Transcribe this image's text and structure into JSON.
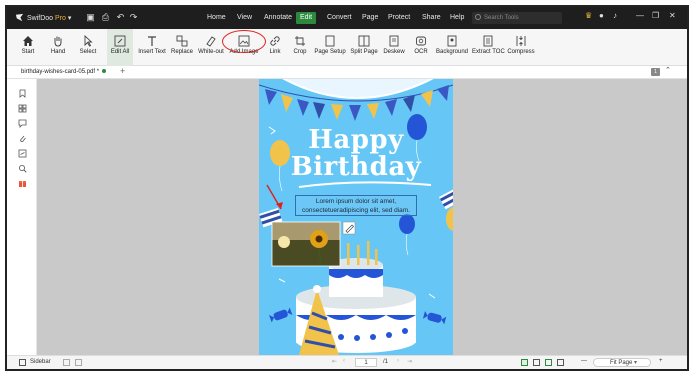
{
  "app": {
    "name": "SwifDoo",
    "badge": "Pro",
    "caret": "▾"
  },
  "menu": [
    {
      "label": "Home"
    },
    {
      "label": "View"
    },
    {
      "label": "Annotate"
    },
    {
      "label": "Edit",
      "active": true
    },
    {
      "label": "Convert"
    },
    {
      "label": "Page"
    },
    {
      "label": "Protect"
    },
    {
      "label": "Share"
    },
    {
      "label": "Help"
    }
  ],
  "search": {
    "placeholder": "Search Tools"
  },
  "toolbar": [
    {
      "label": "Start",
      "icon": "home-icon"
    },
    {
      "label": "Hand",
      "icon": "hand-icon"
    },
    {
      "label": "Select",
      "icon": "cursor-icon"
    },
    {
      "label": "Edit All",
      "icon": "edit-icon",
      "active": true
    },
    {
      "label": "Insert Text",
      "icon": "text-icon"
    },
    {
      "label": "Replace",
      "icon": "replace-icon"
    },
    {
      "label": "White-out",
      "icon": "eraser-icon"
    },
    {
      "label": "Add Image",
      "icon": "image-icon"
    },
    {
      "label": "Link",
      "icon": "link-icon"
    },
    {
      "label": "Crop",
      "icon": "crop-icon"
    },
    {
      "label": "Page Setup",
      "icon": "page-setup-icon"
    },
    {
      "label": "Split Page",
      "icon": "split-icon"
    },
    {
      "label": "Deskew",
      "icon": "deskew-icon"
    },
    {
      "label": "OCR",
      "icon": "ocr-icon"
    },
    {
      "label": "Background",
      "icon": "background-icon"
    },
    {
      "label": "Extract TOC",
      "icon": "toc-icon"
    },
    {
      "label": "Compress",
      "icon": "compress-icon"
    }
  ],
  "tab": {
    "filename": "birthday-wishes-card-05.pdf *",
    "add": "+",
    "count": "1",
    "collapse": "⌃"
  },
  "document": {
    "headline1": "Happy",
    "headline2": "Birthday",
    "body": "Lorem ipsum dolor sit amet, consectetueradipiscing elit, sed diam."
  },
  "status": {
    "sidebar_label": "Sidebar",
    "page_current": "1",
    "page_total": "/1",
    "zoom": "Fit Page",
    "zoom_minus": "—",
    "zoom_plus": "+"
  },
  "colors": {
    "accent": "#2b8a3e",
    "titlebar": "#1e1e1e",
    "highlight": "#e0201c",
    "page": "#66c7f6"
  }
}
